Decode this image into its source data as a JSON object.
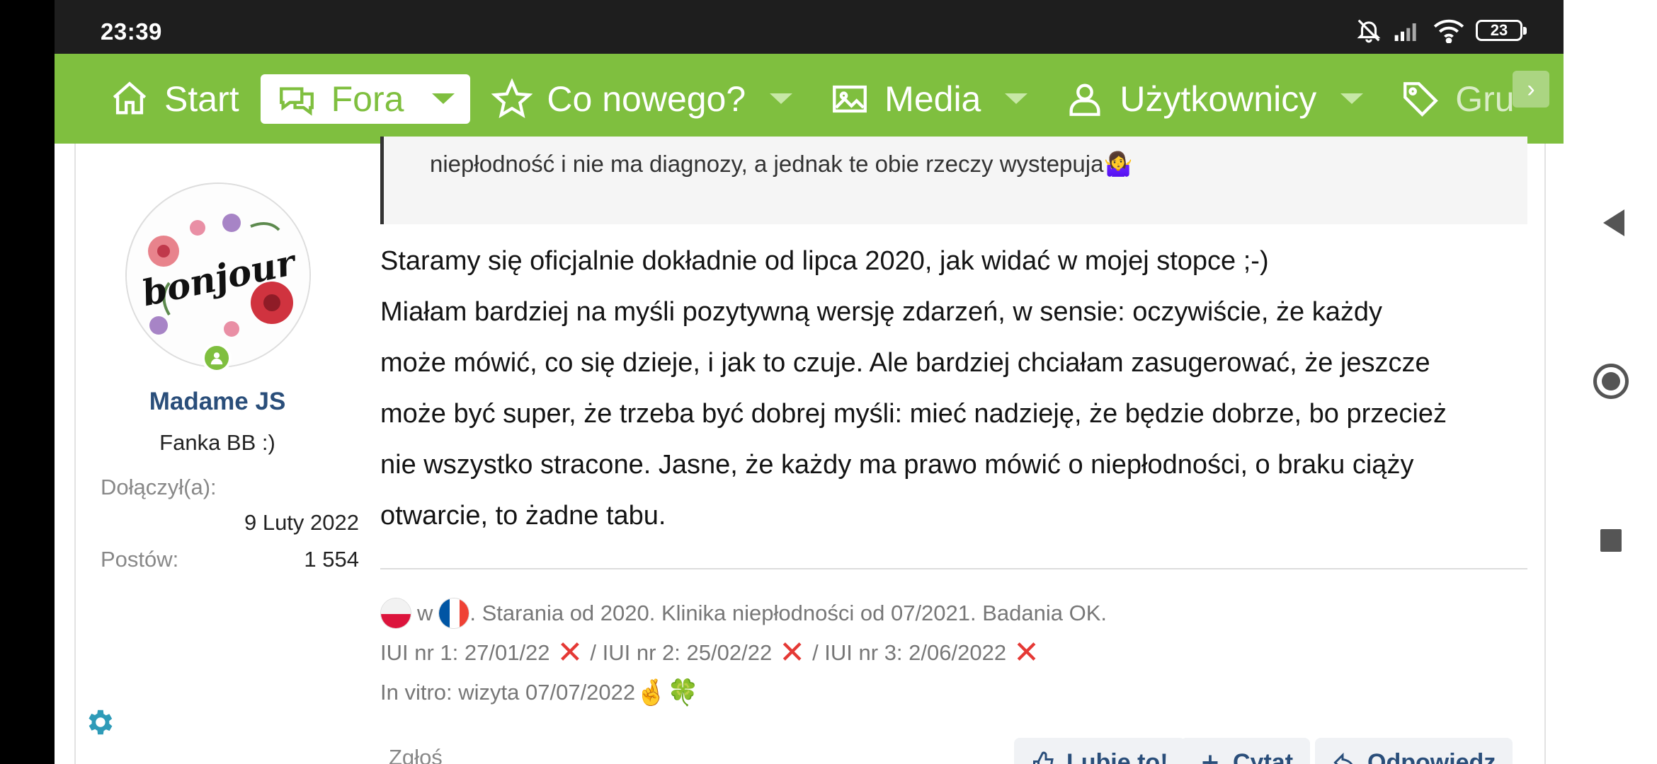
{
  "status_bar": {
    "time": "23:39",
    "battery": "23"
  },
  "nav": {
    "items": [
      {
        "label": "Start",
        "icon": "home-icon",
        "active": false
      },
      {
        "label": "Fora",
        "icon": "chat-icon",
        "active": true
      },
      {
        "label": "Co nowego?",
        "icon": "star-icon",
        "active": false
      },
      {
        "label": "Media",
        "icon": "image-icon",
        "active": false
      },
      {
        "label": "Użytkownicy",
        "icon": "user-icon",
        "active": false
      },
      {
        "label": "Gru",
        "icon": "tag-icon",
        "active": false
      }
    ],
    "next_label": "›",
    "accent": "#7fbf3f"
  },
  "user": {
    "name": "Madame JS",
    "title": "Fanka BB :)",
    "avatar_text": "bonjour",
    "joined_label": "Dołączył(a):",
    "joined_value": "9 Luty 2022",
    "posts_label": "Postów:",
    "posts_value": "1 554"
  },
  "message": {
    "quote": "niepłodność i nie ma diagnozy, a jednak te obie rzeczy wystepuja🤷‍♀️",
    "line1": "Staramy się oficjalnie dokładnie od lipca 2020, jak widać w mojej stopce ;-)",
    "line2": "Miałam bardziej na myśli pozytywną wersję zdarzeń, w sensie: oczywiście, że każdy",
    "line3": "może mówić, co się dzieje, i jak to czuje. Ale bardziej chciałam zasugerować, że jeszcze",
    "line4": "może być super, że trzeba być dobrej myśli: mieć nadzieję, że będzie dobrze, bo przecież",
    "line5": "nie wszystko stracone. Jasne, że każdy ma prawo mówić o niepłodności, o braku ciąży",
    "line6": "otwarcie, to żadne tabu."
  },
  "signature": {
    "w": "w",
    "line1_text": ". Starania od 2020. Klinika niepłodności od 07/2021. Badania OK.",
    "iui1": "IUI nr 1: 27/01/22",
    "iui2": "/ IUI nr 2: 25/02/22",
    "iui3": "/ IUI nr 3: 2/06/2022",
    "x_mark": "✕",
    "invitro": "In vitro: wizyta 07/07/2022",
    "emoji_fingers": "🤞",
    "emoji_clover": "🍀"
  },
  "actions": {
    "report": "Zgłoś",
    "like": "Lubię to!",
    "quote": "Cytat",
    "reply": "Odpowiedz"
  }
}
